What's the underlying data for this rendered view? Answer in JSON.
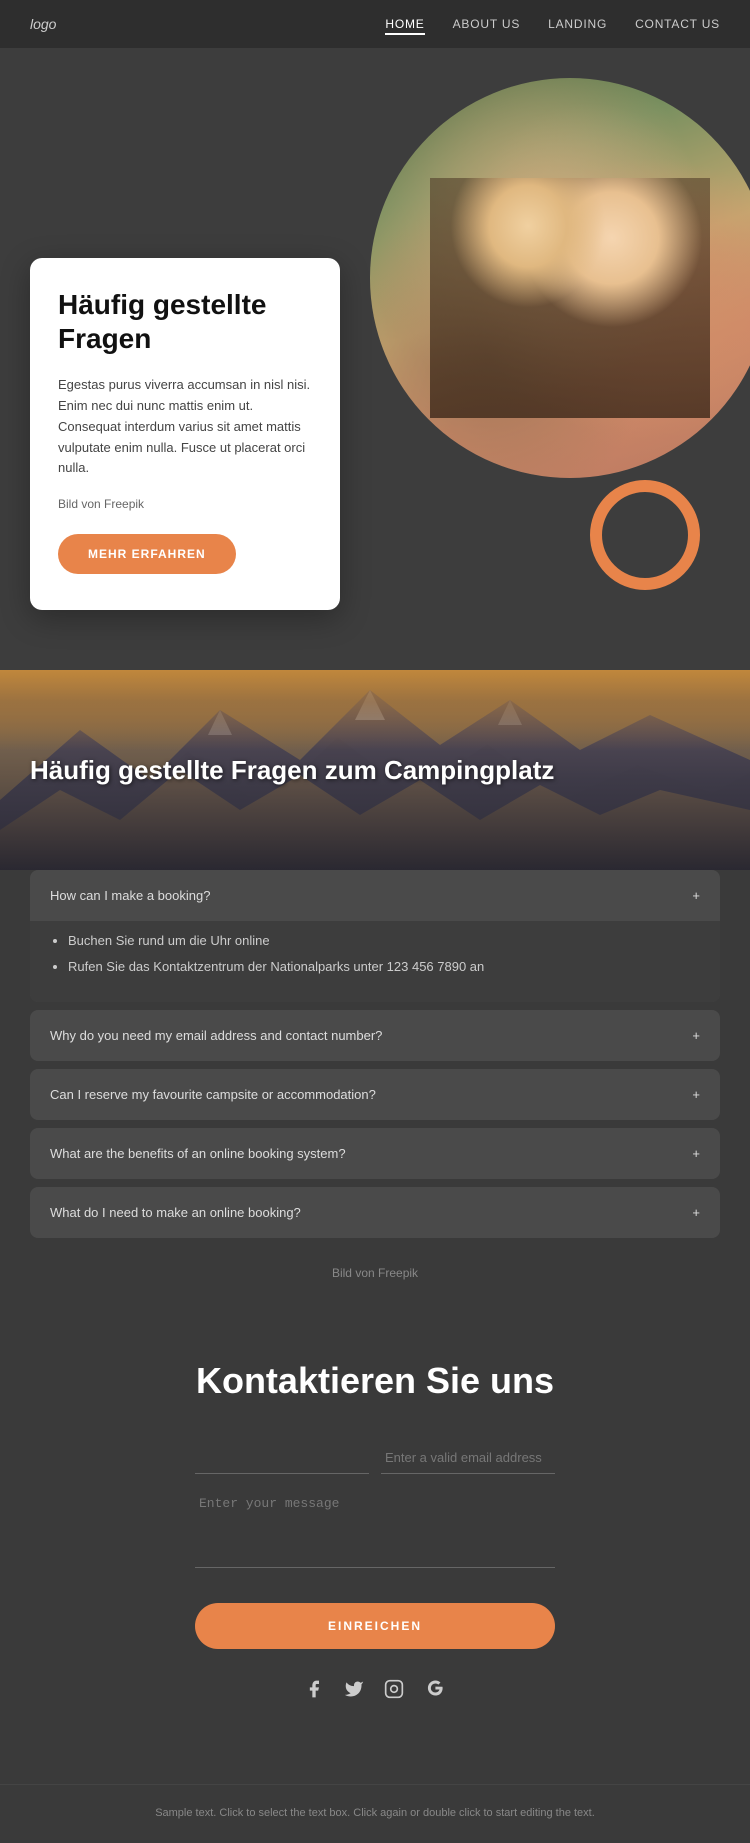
{
  "nav": {
    "logo": "logo",
    "links": [
      {
        "label": "HOME",
        "active": true
      },
      {
        "label": "ABOUT US",
        "active": false
      },
      {
        "label": "LANDING",
        "active": false
      },
      {
        "label": "CONTACT US",
        "active": false
      }
    ]
  },
  "hero": {
    "title": "Häufig gestellte Fragen",
    "description": "Egestas purus viverra accumsan in nisl nisi. Enim nec dui nunc mattis enim ut. Consequat interdum varius sit amet mattis vulputate enim nulla. Fusce ut placerat orci nulla.",
    "attribution_text": "Bild von",
    "attribution_link": "Freepik",
    "cta_button": "MEHR ERFAHREN"
  },
  "mountain_banner": {
    "title": "Häufig gestellte Fragen zum Campingplatz"
  },
  "faq": {
    "items": [
      {
        "question": "How can I make a booking?",
        "expanded": true,
        "answers": [
          "Buchen Sie rund um die Uhr online",
          "Rufen Sie das Kontaktzentrum der Nationalparks unter 123 456 7890 an"
        ]
      },
      {
        "question": "Why do you need my email address and contact number?",
        "expanded": false,
        "answers": []
      },
      {
        "question": "Can I reserve my favourite campsite or accommodation?",
        "expanded": false,
        "answers": []
      },
      {
        "question": "What are the benefits of an online booking system?",
        "expanded": false,
        "answers": []
      },
      {
        "question": "What do I need to make an online booking?",
        "expanded": false,
        "answers": []
      }
    ],
    "attribution_text": "Bild von",
    "attribution_link": "Freepik"
  },
  "contact": {
    "title": "Kontaktieren Sie uns",
    "name_placeholder": "",
    "email_placeholder": "Enter a valid email address",
    "message_placeholder": "Enter your message",
    "submit_button": "EINREICHEN"
  },
  "social": {
    "icons": [
      "f",
      "t",
      "ig",
      "g+"
    ]
  },
  "footer": {
    "text": "Sample text. Click to select the text box. Click again or double click to start editing the text."
  }
}
